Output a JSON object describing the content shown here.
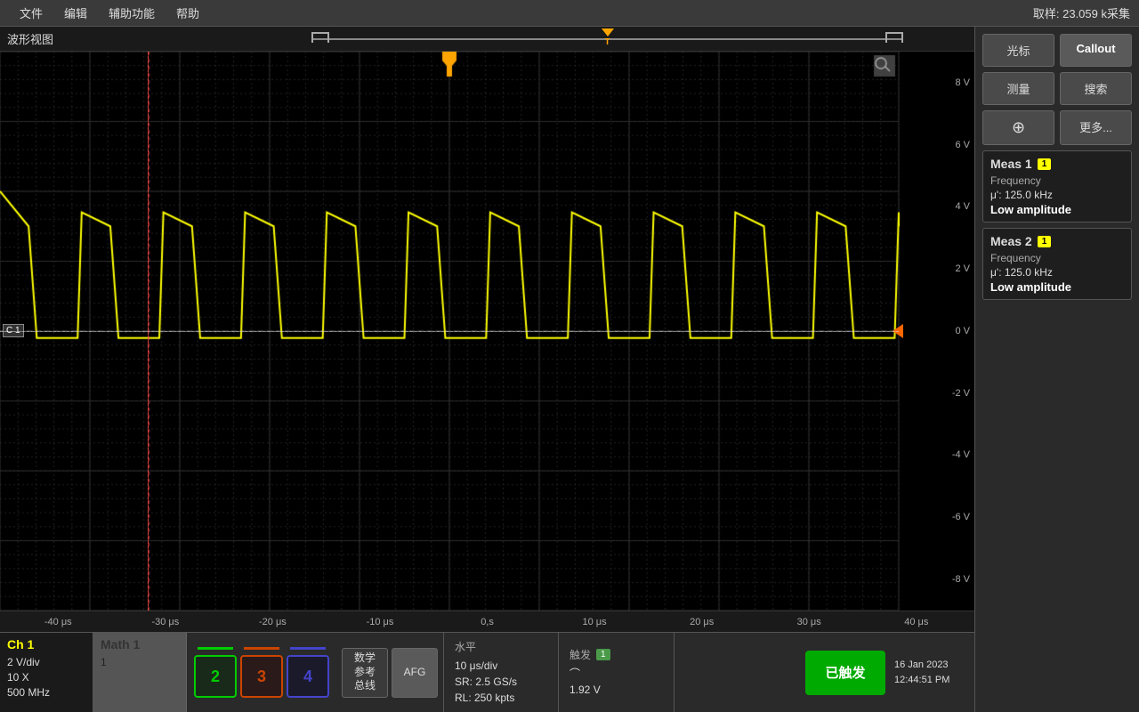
{
  "menu": {
    "items": [
      "文件",
      "编辑",
      "辅助功能",
      "帮助"
    ],
    "sample_info": "取样: 23.059 k采集"
  },
  "waveform": {
    "title": "波形视图",
    "y_labels": [
      "8 V",
      "6 V",
      "4 V",
      "2 V",
      "0 V",
      "-2 V",
      "-4 V",
      "-6 V",
      "-8 V"
    ],
    "x_labels": [
      "-40 μs",
      "-30 μs",
      "-20 μs",
      "-10 μs",
      "0,s",
      "10 μs",
      "20 μs",
      "30 μs",
      "40 μs"
    ],
    "c1_label": "C 1"
  },
  "right_panel": {
    "cursor_label": "光标",
    "callout_label": "Callout",
    "measure_label": "测量",
    "search_label": "搜索",
    "zoom_label": "更多..."
  },
  "meas1": {
    "title": "Meas 1",
    "badge": "1",
    "param1_label": "Frequency",
    "param1_value": "μ': 125.0 kHz",
    "warn": "Low amplitude"
  },
  "meas2": {
    "title": "Meas 2",
    "badge": "1",
    "param1_label": "Frequency",
    "param1_value": "μ': 125.0 kHz",
    "warn": "Low amplitude"
  },
  "ch1": {
    "label": "Ch 1",
    "vdiv": "2 V/div",
    "coupling": "10 X",
    "bw": "500 MHz"
  },
  "math1": {
    "label": "Math 1",
    "value": "1"
  },
  "channels": {
    "ch2_label": "2",
    "ch3_label": "3",
    "ch4_label": "4"
  },
  "func_buttons": {
    "math_ref_label": "数学\n参考\n总线",
    "afg_label": "AFG"
  },
  "horizontal": {
    "header": "水平",
    "div": "10 μs/div",
    "sr": "SR: 2.5 GS/s",
    "rl": "RL: 250 kpts"
  },
  "trigger": {
    "header": "触发",
    "badge": "1",
    "icon": "⌒",
    "level": "1.92 V"
  },
  "triggered_btn": "已触发",
  "datetime": {
    "line1": "16 Jan 2023",
    "line2": "12:44:51 PM"
  }
}
